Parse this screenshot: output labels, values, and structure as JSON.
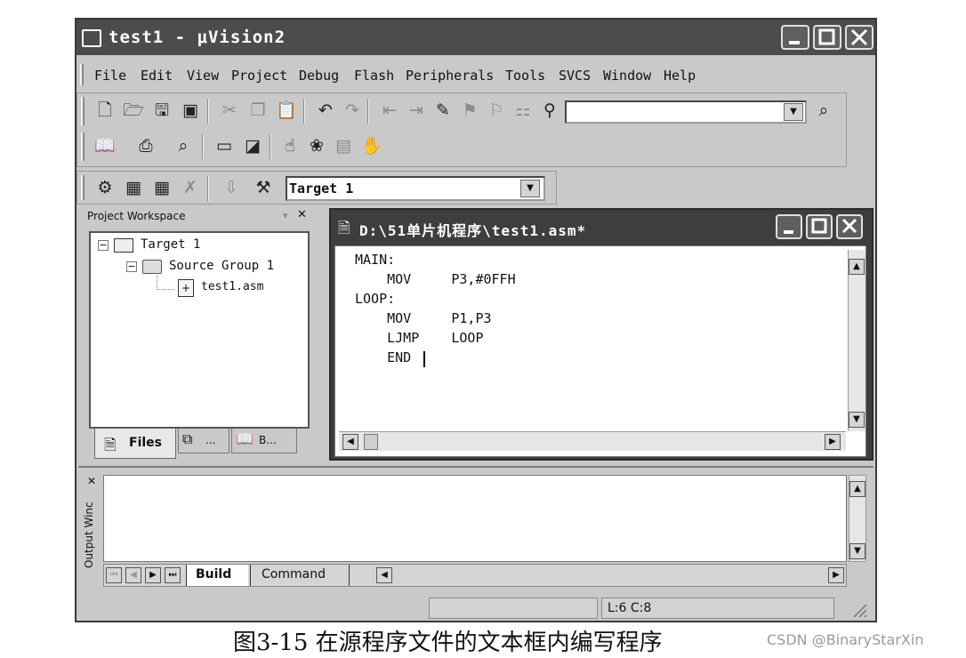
{
  "window": {
    "title": "test1  - μVision2",
    "menu": [
      "File",
      "Edit",
      "View",
      "Project",
      "Debug",
      "Flash",
      "Peripherals",
      "Tools",
      "SVCS",
      "Window",
      "Help"
    ]
  },
  "toolbar": {
    "target_select_value": "Target 1"
  },
  "workspace": {
    "title": "Project Workspace",
    "tree": {
      "target": "Target 1",
      "group": "Source Group 1",
      "file": "test1.asm"
    },
    "tabs": {
      "files": "Files",
      "tab2": "...",
      "tab3": "B..."
    }
  },
  "editor": {
    "title": "D:\\51单片机程序\\test1.asm*",
    "lines": [
      "MAIN:",
      "    MOV     P3,#0FFH",
      "LOOP:",
      "    MOV     P1,P3",
      "    LJMP    LOOP",
      "    END"
    ]
  },
  "output": {
    "side_label": "Output Winc",
    "tabs": {
      "build": "Build",
      "command": "Command"
    }
  },
  "statusbar": {
    "position": "L:6 C:8"
  },
  "caption": "图3-15 在源程序文件的文本框内编写程序",
  "watermark": "CSDN @BinaryStarXin"
}
